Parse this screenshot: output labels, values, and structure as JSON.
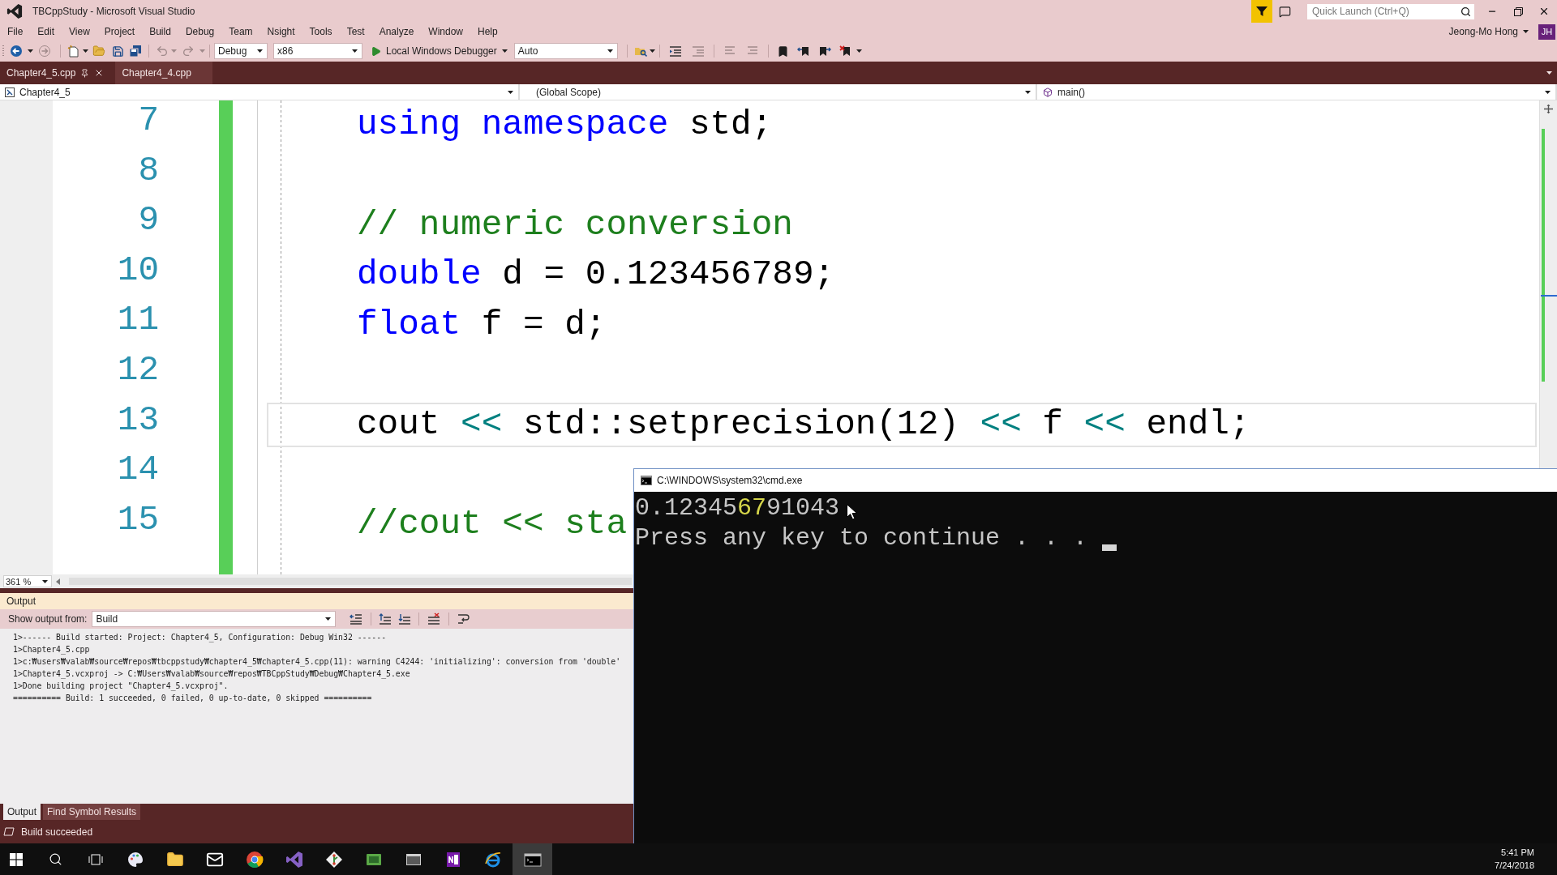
{
  "window": {
    "title": "TBCppStudy - Microsoft Visual Studio"
  },
  "quick_launch": {
    "placeholder": "Quick Launch (Ctrl+Q)"
  },
  "account": {
    "name": "Jeong-Mo Hong",
    "initials": "JH"
  },
  "menu": [
    "File",
    "Edit",
    "View",
    "Project",
    "Build",
    "Debug",
    "Team",
    "Nsight",
    "Tools",
    "Test",
    "Analyze",
    "Window",
    "Help"
  ],
  "toolbar": {
    "configuration": "Debug",
    "platform": "x86",
    "start_button": "Local Windows Debugger",
    "mode": "Auto"
  },
  "document_tabs": [
    {
      "label": "Chapter4_5.cpp",
      "selected": true
    },
    {
      "label": "Chapter4_4.cpp",
      "selected": false
    }
  ],
  "navigation_bar": {
    "project": "Chapter4_5",
    "scope": "(Global Scope)",
    "member": "main()"
  },
  "editor": {
    "zoom": "361 %",
    "lines": [
      {
        "number": "7",
        "current": false,
        "tokens": [
          {
            "kind": "keyword",
            "text": "using"
          },
          {
            "kind": "keyword",
            "text": " namespace"
          },
          {
            "kind": "plain",
            "text": " std;"
          }
        ]
      },
      {
        "number": "8",
        "current": false
      },
      {
        "number": "9",
        "current": false,
        "tokens": [
          {
            "kind": "comment",
            "text": "// numeric conversion"
          }
        ]
      },
      {
        "number": "10",
        "current": false,
        "tokens": [
          {
            "kind": "keyword",
            "text": "double"
          },
          {
            "kind": "plain",
            "text": " d = 0.123456789;"
          }
        ]
      },
      {
        "number": "11",
        "current": false,
        "tokens": [
          {
            "kind": "keyword",
            "text": "float"
          },
          {
            "kind": "plain",
            "text": " f = d;"
          }
        ]
      },
      {
        "number": "12",
        "current": false
      },
      {
        "number": "13",
        "current": true,
        "tokens": [
          {
            "kind": "plain",
            "text": "cout "
          },
          {
            "kind": "operator",
            "text": "<<"
          },
          {
            "kind": "plain",
            "text": " std::setprecision(12) "
          },
          {
            "kind": "operator",
            "text": "<<"
          },
          {
            "kind": "plain",
            "text": " f "
          },
          {
            "kind": "operator",
            "text": "<<"
          },
          {
            "kind": "plain",
            "text": " endl;"
          }
        ]
      },
      {
        "number": "14",
        "current": false
      },
      {
        "number": "15",
        "current": false,
        "tokens": [
          {
            "kind": "comment",
            "text": "//cout << sta"
          }
        ]
      }
    ]
  },
  "output": {
    "title": "Output",
    "source_label": "Show output from:",
    "source": "Build",
    "lines": [
      "1>------ Build started: Project: Chapter4_5, Configuration: Debug Win32 ------",
      "1>Chapter4_5.cpp",
      "1>c:₩users₩valab₩source₩repos₩tbcppstudy₩chapter4_5₩chapter4_5.cpp(11): warning C4244: 'initializing': conversion from 'double'",
      "1>Chapter4_5.vcxproj -> C:₩Users₩valab₩source₩repos₩TBCppStudy₩Debug₩Chapter4_5.exe",
      "1>Done building project \"Chapter4_5.vcxproj\".",
      "========== Build: 1 succeeded, 0 failed, 0 up-to-date, 0 skipped =========="
    ],
    "tabs": [
      {
        "label": "Output",
        "selected": true
      },
      {
        "label": "Find Symbol Results",
        "selected": false
      }
    ]
  },
  "status_bar": {
    "text": "Build succeeded"
  },
  "console": {
    "title": "C:\\WINDOWS\\system32\\cmd.exe",
    "lines": [
      {
        "cursor": false,
        "segments": [
          {
            "text": "0.12345",
            "highlighted": false
          },
          {
            "text": "67",
            "highlighted": true
          },
          {
            "text": "91043",
            "highlighted": false
          }
        ]
      },
      {
        "cursor": true,
        "segments": [
          {
            "text": "Press any key to continue . . .",
            "highlighted": false
          }
        ]
      }
    ]
  },
  "taskbar": {
    "apps": [
      {
        "kind": "palette",
        "selected": false
      },
      {
        "kind": "folder",
        "selected": false
      },
      {
        "kind": "mail",
        "selected": false
      },
      {
        "kind": "browser",
        "selected": false
      },
      {
        "kind": "ribbon",
        "selected": false
      },
      {
        "kind": "diamond",
        "selected": false
      },
      {
        "kind": "card",
        "selected": false
      },
      {
        "kind": "window",
        "selected": false
      },
      {
        "kind": "notebook",
        "selected": false
      },
      {
        "kind": "globe",
        "selected": false
      },
      {
        "kind": "terminal",
        "selected": true
      }
    ],
    "time": "5:41 PM",
    "date": "7/24/2018"
  }
}
